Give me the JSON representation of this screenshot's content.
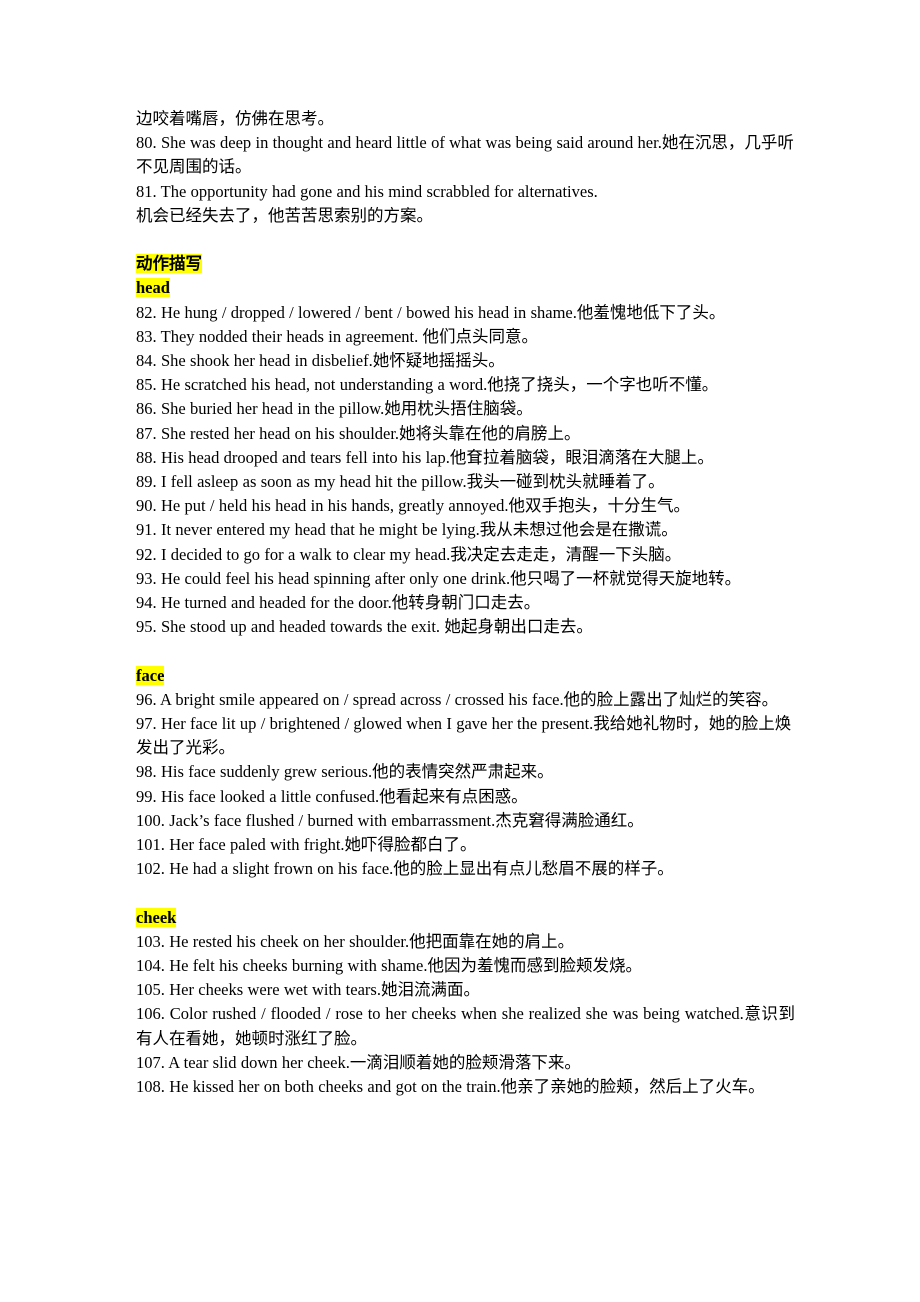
{
  "document": {
    "page_background": "#ffffff",
    "text_color": "#000000",
    "highlight_color": "#ffff00",
    "blocks": [
      {
        "kind": "text",
        "id": "line-79-cont",
        "text": "边咬着嘴唇，仿佛在思考。",
        "justified": false
      },
      {
        "kind": "text",
        "id": "line-80",
        "text": "80. She was deep in thought and heard little of what was being said around her.她在沉思，几乎听不见周围的话。",
        "justified": false
      },
      {
        "kind": "text",
        "id": "line-81",
        "text": "81. The opportunity had gone and his mind scrabbled for alternatives.",
        "justified": false
      },
      {
        "kind": "text",
        "id": "line-81-cont",
        "text": "机会已经失去了，他苦苦思索别的方案。",
        "justified": false
      },
      {
        "kind": "spacer",
        "id": "spacer-1"
      },
      {
        "kind": "heading",
        "id": "section-action-description",
        "text": "动作描写",
        "highlighted": true
      },
      {
        "kind": "heading",
        "id": "section-head",
        "text": "head",
        "highlighted": true
      },
      {
        "kind": "text",
        "id": "line-82",
        "text": "82. He hung / dropped / lowered / bent / bowed his head in shame.他羞愧地低下了头。",
        "justified": false
      },
      {
        "kind": "text",
        "id": "line-83",
        "text": "83. They nodded their heads in agreement.  他们点头同意。",
        "justified": false
      },
      {
        "kind": "text",
        "id": "line-84",
        "text": "84. She shook her head in disbelief.她怀疑地摇摇头。",
        "justified": false
      },
      {
        "kind": "text",
        "id": "line-85",
        "text": "85. He scratched his head, not understanding a word.他挠了挠头，一个字也听不懂。",
        "justified": false
      },
      {
        "kind": "text",
        "id": "line-86",
        "text": "86. She buried her head in the pillow.她用枕头捂住脑袋。",
        "justified": false
      },
      {
        "kind": "text",
        "id": "line-87",
        "text": "87. She rested her head on his shoulder.她将头靠在他的肩膀上。",
        "justified": false
      },
      {
        "kind": "text",
        "id": "line-88",
        "text": "88. His head drooped and tears fell into his lap.他耷拉着脑袋，眼泪滴落在大腿上。",
        "justified": false
      },
      {
        "kind": "text",
        "id": "line-89",
        "text": "89. I fell asleep as soon as my head hit the pillow.我头一碰到枕头就睡着了。",
        "justified": false
      },
      {
        "kind": "text",
        "id": "line-90",
        "text": "90. He put / held his head in his hands, greatly annoyed.他双手抱头，十分生气。",
        "justified": false
      },
      {
        "kind": "text",
        "id": "line-91",
        "text": "91. It never entered my head that he might be lying.我从未想过他会是在撒谎。",
        "justified": false
      },
      {
        "kind": "text",
        "id": "line-92",
        "text": "92. I decided to go for a walk to clear my head.我决定去走走，清醒一下头脑。",
        "justified": false
      },
      {
        "kind": "text",
        "id": "line-93",
        "text": "93. He could feel his head spinning after only one drink.他只喝了一杯就觉得天旋地转。",
        "justified": false
      },
      {
        "kind": "text",
        "id": "line-94",
        "text": "94. He turned and headed for the door.他转身朝门口走去。",
        "justified": false
      },
      {
        "kind": "text",
        "id": "line-95",
        "text": "95. She stood up and headed towards the exit.    她起身朝出口走去。",
        "justified": false
      },
      {
        "kind": "spacer",
        "id": "spacer-2"
      },
      {
        "kind": "heading",
        "id": "section-face",
        "text": "face",
        "highlighted": true
      },
      {
        "kind": "text",
        "id": "line-96",
        "text": "96. A bright smile appeared on / spread across / crossed his face.他的脸上露出了灿烂的笑容。",
        "justified": false
      },
      {
        "kind": "text",
        "id": "line-97",
        "text": "97. Her face lit up / brightened / glowed when I gave her the present.我给她礼物时，她的脸上焕发出了光彩。",
        "justified": false
      },
      {
        "kind": "text",
        "id": "line-98",
        "text": "98. His face suddenly grew serious.他的表情突然严肃起来。",
        "justified": false
      },
      {
        "kind": "text",
        "id": "line-99",
        "text": "99. His face looked a little confused.他看起来有点困惑。",
        "justified": false
      },
      {
        "kind": "text",
        "id": "line-100",
        "text": "100. Jack’s face flushed / burned with embarrassment.杰克窘得满脸通红。",
        "justified": false
      },
      {
        "kind": "text",
        "id": "line-101",
        "text": "101. Her face paled with fright.她吓得脸都白了。",
        "justified": false
      },
      {
        "kind": "text",
        "id": "line-102",
        "text": "102. He had a slight frown on his face.他的脸上显出有点儿愁眉不展的样子。",
        "justified": false
      },
      {
        "kind": "spacer",
        "id": "spacer-3"
      },
      {
        "kind": "heading",
        "id": "section-cheek",
        "text": "cheek",
        "highlighted": true
      },
      {
        "kind": "text",
        "id": "line-103",
        "text": "103. He rested his cheek on her shoulder.他把面靠在她的肩上。",
        "justified": false
      },
      {
        "kind": "text",
        "id": "line-104",
        "text": "104. He felt his cheeks burning with shame.他因为羞愧而感到脸颊发烧。",
        "justified": false
      },
      {
        "kind": "text",
        "id": "line-105",
        "text": "105. Her cheeks were wet with tears.她泪流满面。",
        "justified": false
      },
      {
        "kind": "text",
        "id": "line-106",
        "text": "106. Color rushed / flooded / rose to her cheeks when she realized she was being watched.意识到有人在看她，她顿时涨红了脸。",
        "justified": true
      },
      {
        "kind": "text",
        "id": "line-107",
        "text": "107. A tear slid down her cheek.一滴泪顺着她的脸颊滑落下来。",
        "justified": false
      },
      {
        "kind": "text",
        "id": "line-108",
        "text": "108. He kissed her on both cheeks and got on the train.他亲了亲她的脸颊，然后上了火车。",
        "justified": false
      }
    ]
  }
}
